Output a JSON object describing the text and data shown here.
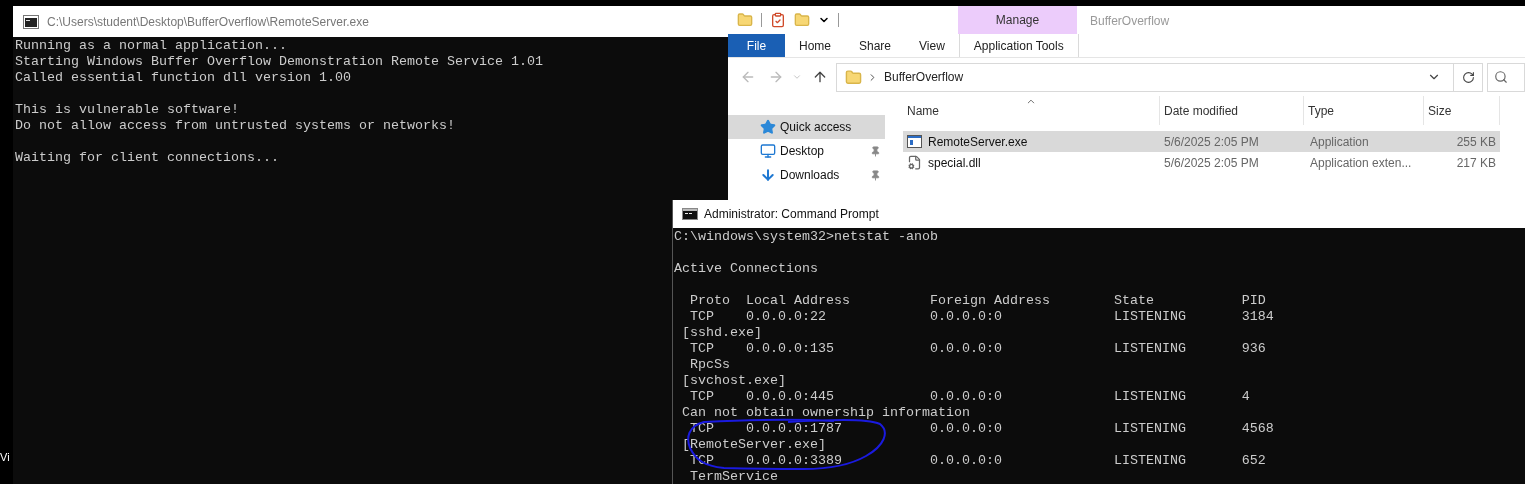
{
  "desktop_label": "Vi",
  "console_window": {
    "title": "C:\\Users\\student\\Desktop\\BufferOverflow\\RemoteServer.exe",
    "paragraphs": [
      [
        "Running as a normal application...",
        "Starting Windows Buffer Overflow Demonstration Remote Service 1.01",
        "Called essential function dll version 1.00"
      ],
      [
        "This is vulnerable software!",
        "Do not allow access from untrusted systems or networks!"
      ],
      [
        "Waiting for client connections..."
      ]
    ]
  },
  "explorer": {
    "title": "BufferOverflow",
    "context_group": "Manage",
    "ribbon_tabs": [
      {
        "label": "File",
        "kind": "file"
      },
      {
        "label": "Home",
        "kind": "tab"
      },
      {
        "label": "Share",
        "kind": "tab"
      },
      {
        "label": "View",
        "kind": "tab"
      },
      {
        "label": "Application Tools",
        "kind": "context"
      }
    ],
    "address": "BufferOverflow",
    "nav_pane": [
      {
        "label": "Quick access",
        "selected": true,
        "pinned": false
      },
      {
        "label": "Desktop",
        "selected": false,
        "pinned": true
      },
      {
        "label": "Downloads",
        "selected": false,
        "pinned": true
      }
    ],
    "columns": [
      {
        "label": "Name",
        "sorted": true
      },
      {
        "label": "Date modified",
        "sorted": false
      },
      {
        "label": "Type",
        "sorted": false
      },
      {
        "label": "Size",
        "sorted": false
      }
    ],
    "files": [
      {
        "name": "RemoteServer.exe",
        "date": "5/6/2025 2:05 PM",
        "type": "Application",
        "size": "255 KB",
        "kind": "exe",
        "selected": true
      },
      {
        "name": "special.dll",
        "date": "5/6/2025 2:05 PM",
        "type": "Application exten...",
        "size": "217 KB",
        "kind": "dll",
        "selected": false
      }
    ]
  },
  "cmd_window": {
    "title": "Administrator: Command Prompt",
    "paragraphs": [
      [
        "C:\\windows\\system32>netstat -anob"
      ],
      [
        "Active Connections"
      ],
      [
        "  Proto  Local Address          Foreign Address        State           PID",
        "  TCP    0.0.0.0:22             0.0.0.0:0              LISTENING       3184",
        " [sshd.exe]",
        "  TCP    0.0.0.0:135            0.0.0.0:0              LISTENING       936",
        "  RpcSs",
        " [svchost.exe]",
        "  TCP    0.0.0.0:445            0.0.0.0:0              LISTENING       4",
        " Can not obtain ownership information",
        "  TCP    0.0.0.0:1787           0.0.0.0:0              LISTENING       4568",
        " [RemoteServer.exe]",
        "  TCP    0.0.0.0:3389           0.0.0.0:0              LISTENING       652",
        "  TermService"
      ]
    ]
  }
}
